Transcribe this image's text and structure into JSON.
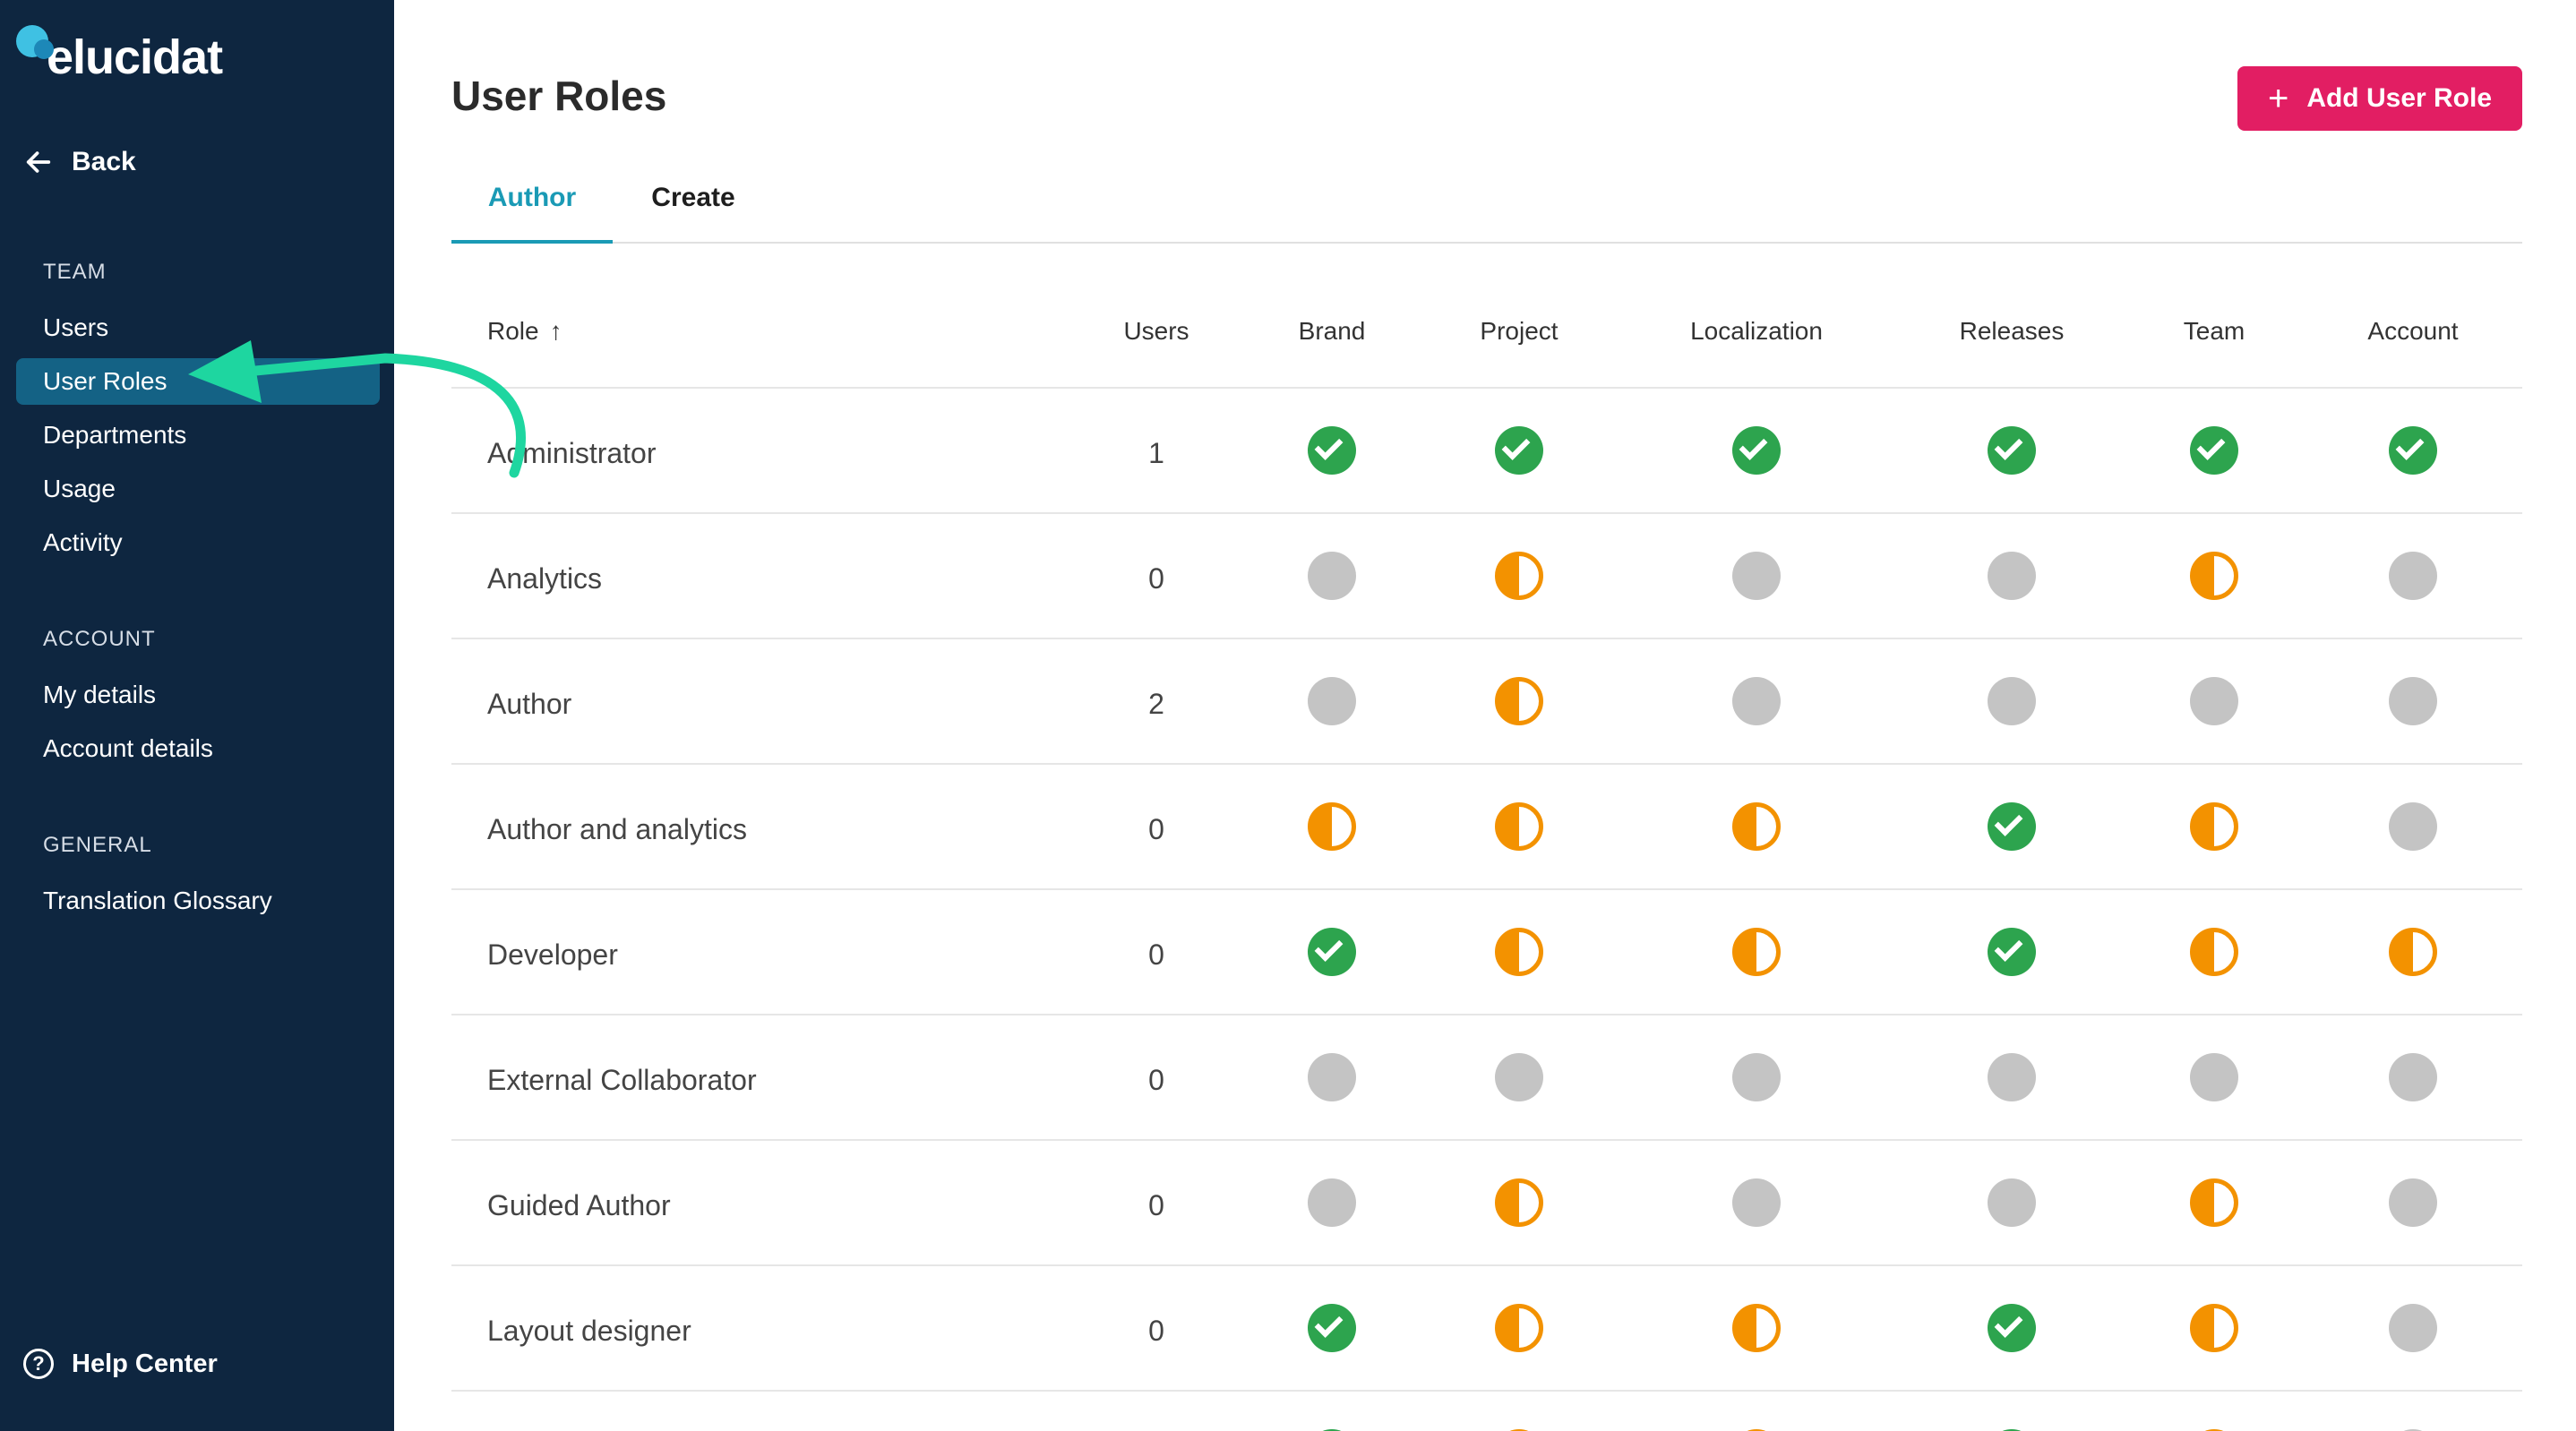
{
  "sidebar": {
    "logo_text": "elucidat",
    "back_label": "Back",
    "sections": [
      {
        "title": "TEAM",
        "items": [
          "Users",
          "User Roles",
          "Departments",
          "Usage",
          "Activity"
        ]
      },
      {
        "title": "ACCOUNT",
        "items": [
          "My details",
          "Account details"
        ]
      },
      {
        "title": "GENERAL",
        "items": [
          "Translation Glossary"
        ]
      }
    ],
    "active_item": "User Roles",
    "help_label": "Help Center"
  },
  "header": {
    "title": "User Roles",
    "add_button_label": "Add User Role"
  },
  "tabs": [
    {
      "label": "Author",
      "active": true
    },
    {
      "label": "Create",
      "active": false
    }
  ],
  "table": {
    "columns": [
      "Role",
      "Users",
      "Brand",
      "Project",
      "Localization",
      "Releases",
      "Team",
      "Account"
    ],
    "sort_column": "Role",
    "sort_direction": "ascending",
    "rows": [
      {
        "role": "Administrator",
        "users": "1",
        "perms": [
          "full",
          "full",
          "full",
          "full",
          "full",
          "full"
        ]
      },
      {
        "role": "Analytics",
        "users": "0",
        "perms": [
          "none",
          "half",
          "none",
          "none",
          "half",
          "none"
        ]
      },
      {
        "role": "Author",
        "users": "2",
        "perms": [
          "none",
          "half",
          "none",
          "none",
          "none",
          "none"
        ]
      },
      {
        "role": "Author and analytics",
        "users": "0",
        "perms": [
          "half",
          "half",
          "half",
          "full",
          "half",
          "none"
        ]
      },
      {
        "role": "Developer",
        "users": "0",
        "perms": [
          "full",
          "half",
          "half",
          "full",
          "half",
          "half"
        ]
      },
      {
        "role": "External Collaborator",
        "users": "0",
        "perms": [
          "none",
          "none",
          "none",
          "none",
          "none",
          "none"
        ]
      },
      {
        "role": "Guided Author",
        "users": "0",
        "perms": [
          "none",
          "half",
          "none",
          "none",
          "half",
          "none"
        ]
      },
      {
        "role": "Layout designer",
        "users": "0",
        "perms": [
          "full",
          "half",
          "half",
          "full",
          "half",
          "none"
        ]
      }
    ]
  },
  "colors": {
    "sidebar_bg": "#0e2640",
    "active_nav": "#146285",
    "accent_teal": "#1a9ab5",
    "button_pink": "#e21e63",
    "perm_full": "#2da44e",
    "perm_half": "#f39200",
    "perm_none": "#c4c4c4",
    "annotation_arrow": "#1ed6a0"
  }
}
